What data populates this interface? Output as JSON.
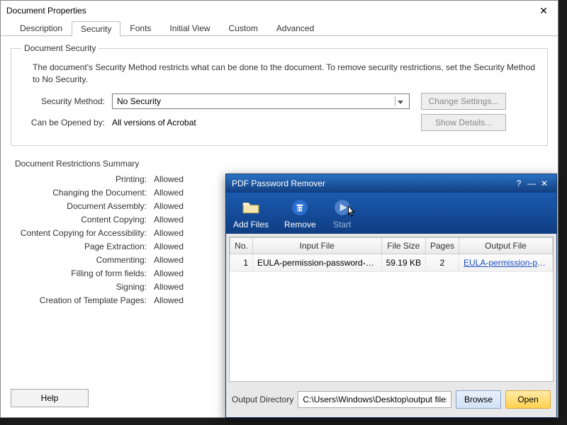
{
  "docprops": {
    "title": "Document Properties",
    "tabs": [
      "Description",
      "Security",
      "Fonts",
      "Initial View",
      "Custom",
      "Advanced"
    ],
    "active_tab": 1,
    "security": {
      "groupTitle": "Document Security",
      "description": "The document's Security Method restricts what can be done to the document. To remove security restrictions, set the Security Method to No Security.",
      "methodLabel": "Security Method:",
      "methodValue": "No Security",
      "changeSettings": "Change Settings...",
      "openedByLabel": "Can be Opened by:",
      "openedByValue": "All versions of Acrobat",
      "showDetails": "Show Details..."
    },
    "restrictions": {
      "heading": "Document Restrictions Summary",
      "rows": [
        {
          "k": "Printing:",
          "v": "Allowed"
        },
        {
          "k": "Changing the Document:",
          "v": "Allowed"
        },
        {
          "k": "Document Assembly:",
          "v": "Allowed"
        },
        {
          "k": "Content Copying:",
          "v": "Allowed"
        },
        {
          "k": "Content Copying for Accessibility:",
          "v": "Allowed"
        },
        {
          "k": "Page Extraction:",
          "v": "Allowed"
        },
        {
          "k": "Commenting:",
          "v": "Allowed"
        },
        {
          "k": "Filling of form fields:",
          "v": "Allowed"
        },
        {
          "k": "Signing:",
          "v": "Allowed"
        },
        {
          "k": "Creation of Template Pages:",
          "v": "Allowed"
        }
      ]
    },
    "help": "Help"
  },
  "remover": {
    "title": "PDF Password Remover",
    "toolbar": {
      "addFiles": "Add Files",
      "remove": "Remove",
      "start": "Start"
    },
    "columns": {
      "no": "No.",
      "input": "Input File",
      "size": "File Size",
      "pages": "Pages",
      "output": "Output File"
    },
    "rows": [
      {
        "no": "1",
        "input": "EULA-permission-password-prot...",
        "size": "59.19 KB",
        "pages": "2",
        "output": "EULA-permission-pass..."
      }
    ],
    "outDirLabel": "Output Directory",
    "outDirValue": "C:\\Users\\Windows\\Desktop\\output files",
    "browse": "Browse",
    "open": "Open"
  }
}
